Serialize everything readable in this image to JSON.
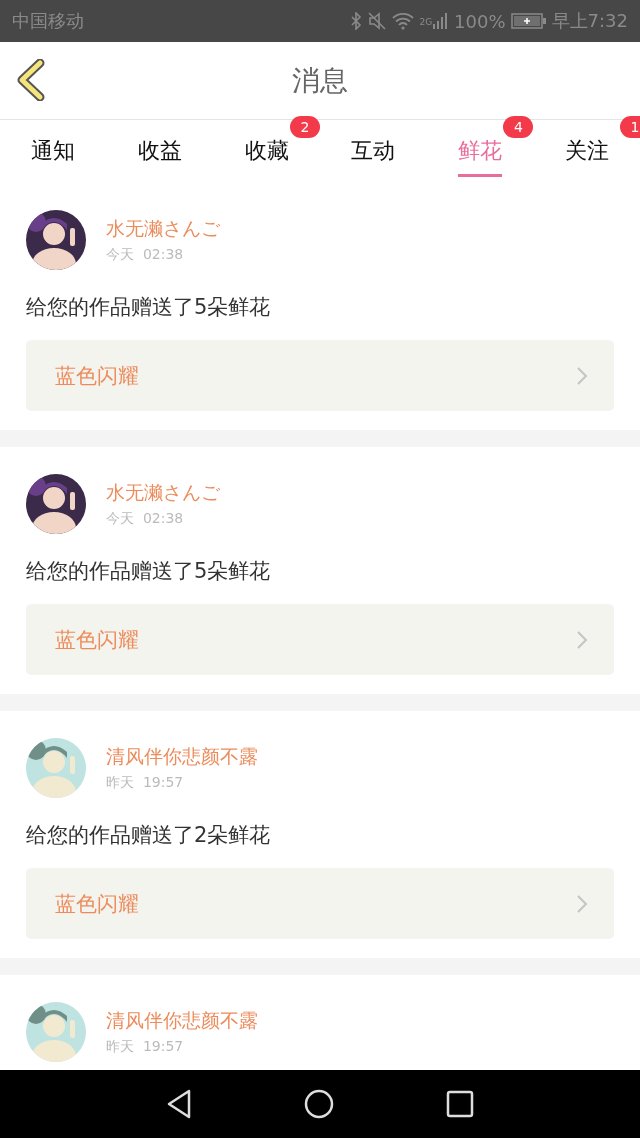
{
  "status_bar": {
    "carrier": "中国移动",
    "network": "2G",
    "battery": "100%",
    "time": "早上7:32"
  },
  "header": {
    "title": "消息"
  },
  "tabs": [
    {
      "label": "通知",
      "selected": false
    },
    {
      "label": "收益",
      "selected": false
    },
    {
      "label": "收藏",
      "selected": false,
      "badge": "2"
    },
    {
      "label": "互动",
      "selected": false
    },
    {
      "label": "鲜花",
      "selected": true,
      "badge": "4"
    },
    {
      "label": "关注",
      "selected": false,
      "badge": "1"
    }
  ],
  "messages": [
    {
      "name": "水无濑さんご",
      "time": "今天  02:38",
      "text": "给您的作品赠送了5朵鲜花",
      "work": "蓝色闪耀"
    },
    {
      "name": "水无濑さんご",
      "time": "今天  02:38",
      "text": "给您的作品赠送了5朵鲜花",
      "work": "蓝色闪耀"
    },
    {
      "name": "清风伴你悲颜不露",
      "time": "昨天  19:57",
      "text": "给您的作品赠送了2朵鲜花",
      "work": "蓝色闪耀"
    },
    {
      "name": "清风伴你悲颜不露",
      "time": "昨天  19:57"
    }
  ]
}
